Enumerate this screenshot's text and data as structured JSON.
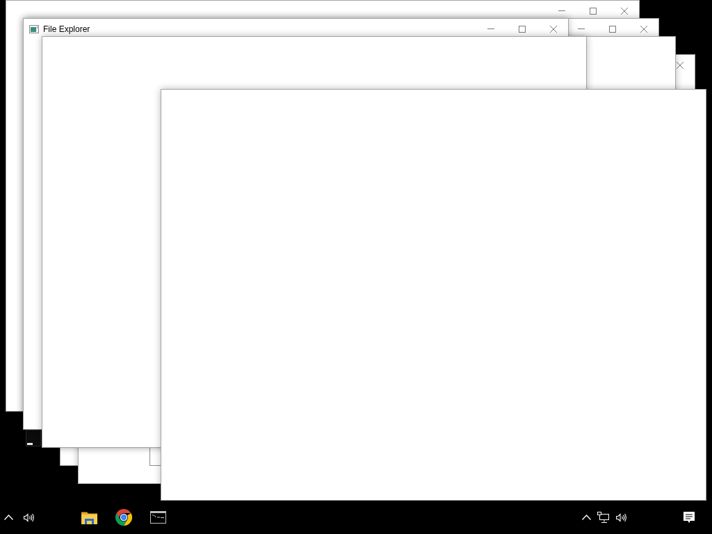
{
  "windows": [
    {
      "kind": "window",
      "controls": [
        {
          "kind": "minimize"
        },
        {
          "kind": "maximize"
        },
        {
          "kind": "close"
        }
      ]
    },
    {
      "kind": "window",
      "controls": [
        {
          "kind": "minimize"
        },
        {
          "kind": "maximize"
        },
        {
          "kind": "close"
        }
      ]
    },
    {
      "kind": "window",
      "controls": [
        {
          "kind": "close"
        }
      ]
    },
    {
      "kind": "window"
    },
    {
      "kind": "frame"
    },
    {
      "kind": "window"
    },
    {
      "kind": "console"
    },
    {
      "kind": "window",
      "title": "File Explorer",
      "controls": [
        {
          "kind": "minimize"
        },
        {
          "kind": "maximize"
        },
        {
          "kind": "close"
        }
      ]
    },
    {
      "kind": "window"
    },
    {
      "kind": "window"
    }
  ],
  "taskbar": {
    "tray_left": [
      {
        "kind": "chevron"
      },
      {
        "kind": "volume"
      }
    ],
    "pinned": [
      {
        "kind": "file_explorer"
      },
      {
        "kind": "browser"
      },
      {
        "kind": "terminal"
      }
    ],
    "tray_right": [
      {
        "kind": "chevron"
      },
      {
        "kind": "network"
      },
      {
        "kind": "volume"
      },
      {
        "kind": "notifications"
      }
    ]
  }
}
